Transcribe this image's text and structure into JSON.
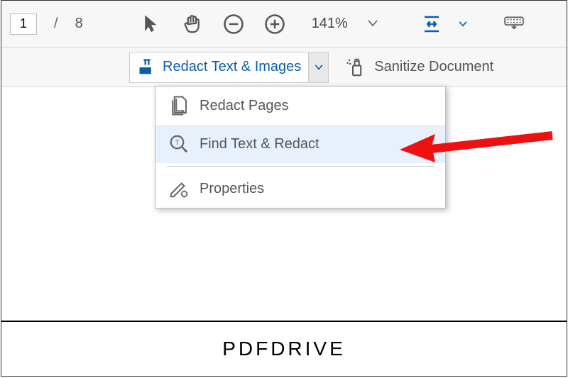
{
  "toolbar": {
    "page_current": "1",
    "page_separator": "/",
    "page_total": "8",
    "zoom_level": "141%"
  },
  "secondary": {
    "redact_label": "Redact Text & Images",
    "sanitize_label": "Sanitize Document"
  },
  "dropdown": {
    "items": [
      {
        "label": "Redact Pages"
      },
      {
        "label": "Find Text & Redact"
      },
      {
        "label": "Properties"
      }
    ]
  },
  "footer": {
    "brand": "PDFDRIVE"
  }
}
